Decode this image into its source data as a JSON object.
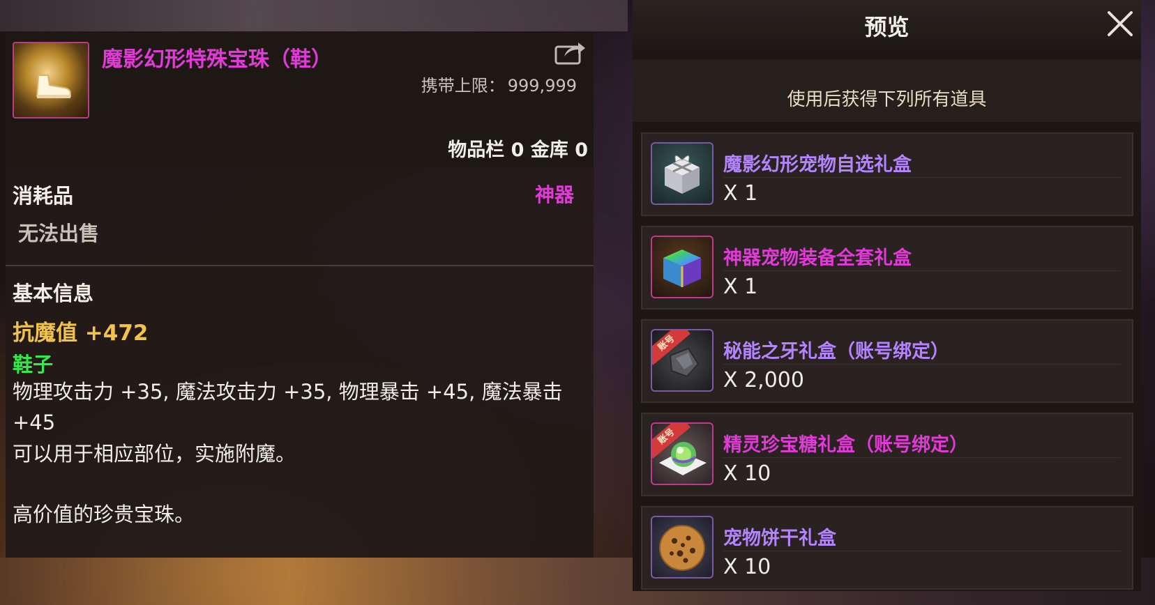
{
  "item": {
    "name": "魔影幻形特殊宝珠（鞋）",
    "carry_limit_label": "携带上限：",
    "carry_limit_value": "999,999",
    "storage": "物品栏 0 金库 0",
    "category": "消耗品",
    "rarity": "神器",
    "sell_status": "无法出售",
    "basic_info_label": "基本信息",
    "resist": "抗魔值 +472",
    "slot": "鞋子",
    "stats": "物理攻击力 +35, 魔法攻击力 +35, 物理暴击 +45, 魔法暴击 +45",
    "usage": "可以用于相应部位，实施附魔。",
    "description": "高价值的珍贵宝珠。",
    "icon": "gold-shoe-orb-icon"
  },
  "preview": {
    "title": "预览",
    "subtitle": "使用后获得下列所有道具",
    "close_icon": "close-icon",
    "rewards": [
      {
        "name": "魔影幻形宠物自选礼盒",
        "qty": "X 1",
        "color": "#b483ff",
        "icon": "gift-box-icon",
        "badge": ""
      },
      {
        "name": "神器宠物装备全套礼盒",
        "qty": "X 1",
        "color": "#e23ad8",
        "icon": "rainbow-box-icon",
        "badge": ""
      },
      {
        "name": "秘能之牙礼盒（账号绑定）",
        "qty": "X 2,000",
        "color": "#b483ff",
        "icon": "stone-fang-icon",
        "badge": "账号"
      },
      {
        "name": "精灵珍宝糖礼盒（账号绑定）",
        "qty": "X 10",
        "color": "#e23ad8",
        "icon": "candy-orb-icon",
        "badge": "账号"
      },
      {
        "name": "宠物饼干礼盒",
        "qty": "X 10",
        "color": "#b483ff",
        "icon": "cookie-icon",
        "badge": ""
      }
    ]
  },
  "colors": {
    "epic_purple": "#b483ff",
    "artifact_magenta": "#e23ad8",
    "resist_gold": "#f1c34a",
    "slot_green": "#35e84c"
  }
}
